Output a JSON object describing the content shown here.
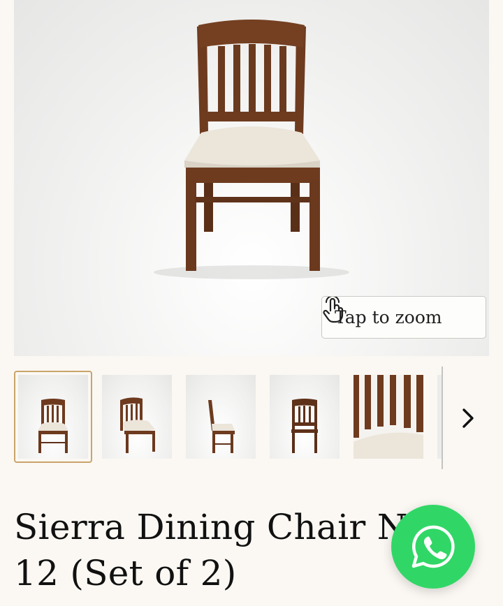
{
  "product": {
    "title": "Sierra Dining Chair No. 12 (Set of 2)"
  },
  "gallery": {
    "zoom_label": "Tap to zoom",
    "thumbnails": [
      {
        "view": "front"
      },
      {
        "view": "three-quarter"
      },
      {
        "view": "side"
      },
      {
        "view": "back"
      },
      {
        "view": "detail-closeup"
      }
    ],
    "next_icon": "chevron-right-icon"
  },
  "whatsapp": {
    "icon": "whatsapp-icon",
    "color": "#30d766"
  },
  "colors": {
    "wood": "#6b3a1f",
    "seat": "#e9e3d8",
    "active_thumb_border": "#c9a46a",
    "background": "#fbf8f3"
  }
}
